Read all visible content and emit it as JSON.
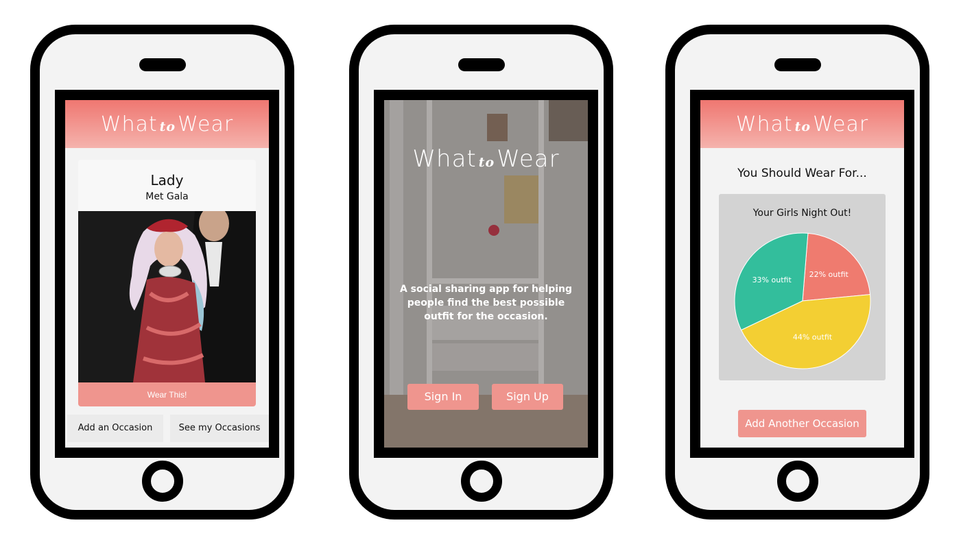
{
  "app": {
    "logo_left": "What",
    "logo_mid": "to",
    "logo_right": "Wear"
  },
  "screen1": {
    "card_name": "Lady",
    "card_event": "Met Gala",
    "wear_button": "Wear This!",
    "tabs": [
      {
        "label": "Add an Occasion"
      },
      {
        "label": "See my Occasions"
      }
    ]
  },
  "screen2": {
    "tagline": "A social sharing app for helping people find the best possible outfit for the occasion.",
    "sign_in": "Sign In",
    "sign_up": "Sign Up"
  },
  "screen3": {
    "title": "You Should Wear For...",
    "add_button": "Add Another Occasion"
  },
  "chart_data": {
    "type": "pie",
    "title": "Your Girls Night Out!",
    "slices": [
      {
        "label": "22% outfit",
        "value": 22,
        "color": "#ef7b6f"
      },
      {
        "label": "44% outfit",
        "value": 44,
        "color": "#f3cf33"
      },
      {
        "label": "33% outfit",
        "value": 33,
        "color": "#33be9c"
      }
    ]
  },
  "colors": {
    "accent": "#ef958e",
    "header_top": "#ef7771",
    "header_bottom": "#f5b3ad"
  }
}
